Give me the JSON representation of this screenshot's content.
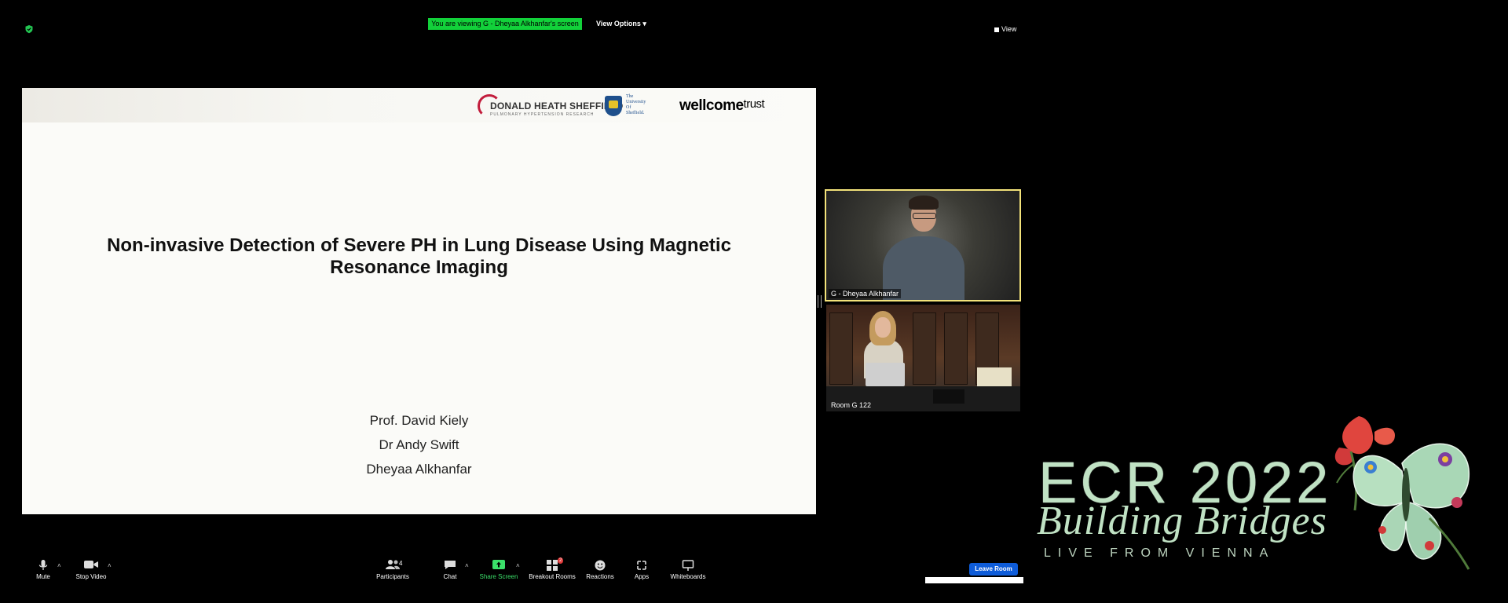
{
  "topbar": {
    "viewing_banner": "You are viewing G - Dheyaa Alkhanfar's screen",
    "view_options": "View Options",
    "view_label": "View"
  },
  "slide": {
    "logo_dhs_name": "DONALD HEATH SHEFFIELD",
    "logo_dhs_sub": "PULMONARY HYPERTENSION RESEARCH",
    "logo_uos_lines": [
      "The",
      "University",
      "Of",
      "Sheffield."
    ],
    "logo_wt_bold": "wellcome",
    "logo_wt_light": "trust",
    "title": "Non-invasive Detection of Severe PH in Lung Disease Using Magnetic Resonance Imaging",
    "authors": [
      "Prof. David Kiely",
      "Dr Andy Swift",
      "Dheyaa Alkhanfar"
    ]
  },
  "videos": {
    "active_speaker": "G - Dheyaa Alkhanfar",
    "room": "Room G 122"
  },
  "toolbar": {
    "mute": "Mute",
    "stop_video": "Stop Video",
    "participants": "Participants",
    "participants_count": "4",
    "chat": "Chat",
    "share_screen": "Share Screen",
    "breakout_rooms": "Breakout Rooms",
    "breakout_badge": "2",
    "reactions": "Reactions",
    "apps": "Apps",
    "whiteboards": "Whiteboards",
    "leave_room": "Leave Room"
  },
  "branding": {
    "main": "ECR 2022",
    "script": "Building Bridges",
    "live": "LIVE FROM VIENNA"
  },
  "colors": {
    "banner_green": "#12d13a",
    "share_green": "#3be06a",
    "leave_blue": "#0e5cd9",
    "speaker_border": "#f3e27a",
    "ecr_text": "#c0e2c4"
  }
}
